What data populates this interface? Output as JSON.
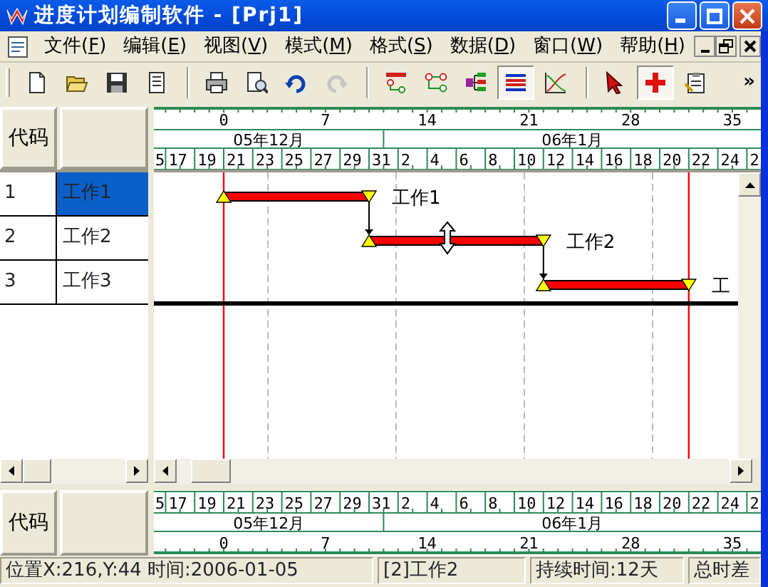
{
  "window": {
    "title": "进度计划编制软件 - [Prj1]"
  },
  "menu": [
    {
      "label": "文件(F)"
    },
    {
      "label": "编辑(E)"
    },
    {
      "label": "视图(V)"
    },
    {
      "label": "模式(M)"
    },
    {
      "label": "格式(S)"
    },
    {
      "label": "数据(D)"
    },
    {
      "label": "窗口(W)"
    },
    {
      "label": "帮助(H)"
    }
  ],
  "toolbar": {
    "groups": [
      [
        {
          "kind": "new",
          "pressed": false,
          "disabled": false
        },
        {
          "kind": "open",
          "pressed": false,
          "disabled": false
        },
        {
          "kind": "save",
          "pressed": false,
          "disabled": false
        },
        {
          "kind": "page",
          "pressed": false,
          "disabled": false
        }
      ],
      [
        {
          "kind": "print",
          "pressed": false,
          "disabled": false
        },
        {
          "kind": "preview",
          "pressed": false,
          "disabled": false
        },
        {
          "kind": "undo",
          "pressed": false,
          "disabled": false
        },
        {
          "kind": "redo",
          "pressed": false,
          "disabled": true
        }
      ],
      [
        {
          "kind": "network",
          "pressed": false,
          "disabled": false
        },
        {
          "kind": "nodes",
          "pressed": false,
          "disabled": false
        },
        {
          "kind": "tree",
          "pressed": false,
          "disabled": false
        },
        {
          "kind": "bars",
          "pressed": true,
          "disabled": false
        },
        {
          "kind": "curve",
          "pressed": false,
          "disabled": false
        }
      ],
      [
        {
          "kind": "pointer",
          "pressed": false,
          "disabled": false
        },
        {
          "kind": "plus",
          "pressed": true,
          "disabled": false
        },
        {
          "kind": "sheet",
          "pressed": false,
          "disabled": false
        }
      ]
    ],
    "overflow": "»"
  },
  "grid": {
    "header": "代码",
    "rows": [
      {
        "code": "1",
        "name": "工作1",
        "selected": true
      },
      {
        "code": "2",
        "name": "工作2",
        "selected": false
      },
      {
        "code": "3",
        "name": "工作3",
        "selected": false
      }
    ]
  },
  "timeline": {
    "week_ticks": [
      "0",
      "7",
      "14",
      "21",
      "28",
      "35"
    ],
    "months": [
      "05年12月",
      "06年1月"
    ],
    "date_labels": [
      "5",
      "17",
      "19",
      "21",
      "23",
      "25",
      "27",
      "29",
      "31",
      "2",
      "4",
      "6",
      "8",
      "10",
      "12",
      "14",
      "16",
      "18",
      "20",
      "22",
      "24",
      "2"
    ]
  },
  "tasks": [
    {
      "label": "工作1",
      "linked_to_previous": false
    },
    {
      "label": "工作2",
      "linked_to_previous": true
    },
    {
      "label": "工",
      "linked_to_previous": true
    }
  ],
  "bottom_grid": {
    "header": "代码"
  },
  "bottom_timeline": {
    "week_ticks": [
      "0",
      "7",
      "14",
      "21",
      "28",
      "35"
    ],
    "months": [
      "05年12月",
      "06年1月"
    ],
    "date_labels": [
      "5",
      "17",
      "19",
      "21",
      "23",
      "25",
      "27",
      "29",
      "31",
      "2",
      "4",
      "6",
      "8",
      "10",
      "12",
      "14",
      "16",
      "18",
      "20",
      "22",
      "24",
      "2"
    ]
  },
  "status_bar": [
    "位置X:216,Y:44 时间:2006-01-05",
    "[2]工作2",
    "持续时间:12天",
    "总时差"
  ]
}
